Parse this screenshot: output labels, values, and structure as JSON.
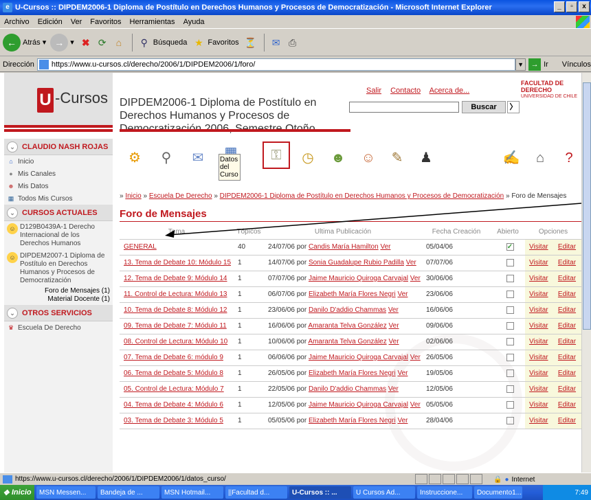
{
  "window": {
    "title": "U-Cursos :: DIPDEM2006-1 Diploma de Postítulo en Derechos Humanos y Procesos de Democratización - Microsoft Internet Explorer",
    "min": "_",
    "restore": "▫",
    "close": "x"
  },
  "menu": [
    "Archivo",
    "Edición",
    "Ver",
    "Favoritos",
    "Herramientas",
    "Ayuda"
  ],
  "toolbar": {
    "back": "Atrás",
    "search": "Búsqueda",
    "favorites": "Favoritos"
  },
  "address": {
    "label": "Dirección",
    "url": "https://www.u-cursos.cl/derecho/2006/1/DIPDEM2006/1/foro/",
    "go": "Ir",
    "links": "Vínculos"
  },
  "site": {
    "logo_letter": "U",
    "logo_text": "-Cursos",
    "course_title": "DIPDEM2006-1 Diploma de Postítulo en Derechos Humanos y Procesos de Democratización 2006, Semestre Otoño",
    "links": [
      "Salir",
      "Contacto",
      "Acerca de..."
    ],
    "search_button": "Buscar",
    "search_arrow": "〉",
    "faculty": "FACULTAD DE DERECHO",
    "faculty_sub": "UNIVERSIDAD DE CHILE"
  },
  "sidebar": {
    "user": "CLAUDIO NASH ROJAS",
    "user_items": [
      "Inicio",
      "Mis Canales",
      "Mis Datos",
      "Todos Mis Cursos"
    ],
    "current_courses_header": "CURSOS ACTUALES",
    "courses": [
      "D129B0439A-1 Derecho Internacional de los Derechos Humanos",
      "DIPDEM2007-1 Diploma de Postítulo en Derechos Humanos y Procesos de Democratización"
    ],
    "course_sub": [
      "Foro de Mensajes (1)",
      "Material Docente (1)"
    ],
    "other_header": "OTROS SERVICIOS",
    "other_items": [
      "Escuela De Derecho"
    ]
  },
  "iconbar": {
    "tooltip": "Datos del Curso"
  },
  "breadcrumb": {
    "prefix": "»",
    "items": [
      "Inicio",
      "Escuela De Derecho",
      "DIPDEM2006-1 Diploma de Postítulo en Derechos Humanos y Procesos de Democratización"
    ],
    "current": "Foro de Mensajes"
  },
  "forum": {
    "title": "Foro de Mensajes",
    "columns": [
      "Tema",
      "Tópicos",
      "Ultima Publicación",
      "Fecha Creación",
      "Abierto",
      "Opciones"
    ],
    "visit": "Visitar",
    "edit": "Editar",
    "rows": [
      {
        "tema": "GENERAL",
        "topicos": "40",
        "fecha": "24/07/06",
        "autor": "Candis María Hamilton",
        "creacion": "05/04/06",
        "abierto": true
      },
      {
        "tema": "13. Tema de Debate 10: Módulo 15",
        "topicos": "1",
        "fecha": "14/07/06",
        "autor": "Sonia Guadalupe Rubio Padilla",
        "creacion": "07/07/06",
        "abierto": false
      },
      {
        "tema": "12. Tema de Debate 9: Módulo 14",
        "topicos": "1",
        "fecha": "07/07/06",
        "autor": "Jaime Mauricio Quiroga Carvajal",
        "creacion": "30/06/06",
        "abierto": false
      },
      {
        "tema": "11. Control de Lectura: Módulo 13",
        "topicos": "1",
        "fecha": "06/07/06",
        "autor": "Elizabeth María Flores Negri",
        "creacion": "23/06/06",
        "abierto": false
      },
      {
        "tema": "10. Tema de Debate 8: Módulo 12",
        "topicos": "1",
        "fecha": "23/06/06",
        "autor": "Danilo D'addio Chammas",
        "creacion": "16/06/06",
        "abierto": false
      },
      {
        "tema": "09. Tema de Debate 7: Módulo 11",
        "topicos": "1",
        "fecha": "16/06/06",
        "autor": "Amaranta Telva González",
        "creacion": "09/06/06",
        "abierto": false
      },
      {
        "tema": "08. Control de Lectura: Módulo 10",
        "topicos": "1",
        "fecha": "10/06/06",
        "autor": "Amaranta Telva González",
        "creacion": "02/06/06",
        "abierto": false
      },
      {
        "tema": "07. Tema de Debate 6: módulo 9",
        "topicos": "1",
        "fecha": "06/06/06",
        "autor": "Jaime Mauricio Quiroga Carvajal",
        "creacion": "26/05/06",
        "abierto": false
      },
      {
        "tema": "06. Tema de Debate 5: Módulo 8",
        "topicos": "1",
        "fecha": "26/05/06",
        "autor": "Elizabeth María Flores Negri",
        "creacion": "19/05/06",
        "abierto": false
      },
      {
        "tema": "05. Control de Lectura: Módulo 7",
        "topicos": "1",
        "fecha": "22/05/06",
        "autor": "Danilo D'addio Chammas",
        "creacion": "12/05/06",
        "abierto": false
      },
      {
        "tema": "04. Tema de Debate 4: Módulo 6",
        "topicos": "1",
        "fecha": "12/05/06",
        "autor": "Jaime Mauricio Quiroga Carvajal",
        "creacion": "05/05/06",
        "abierto": false
      },
      {
        "tema": "03. Tema de Debate 3: Módulo 5",
        "topicos": "1",
        "fecha": "05/05/06",
        "autor": "Elizabeth María Flores Negri",
        "creacion": "28/04/06",
        "abierto": false
      }
    ],
    "por": "por",
    "ver": "Ver"
  },
  "status": {
    "url": "https://www.u-cursos.cl/derecho/2006/1/DIPDEM2006/1/datos_curso/",
    "zone": "Internet"
  },
  "taskbar": {
    "start": "Inicio",
    "tasks": [
      "MSN Messen...",
      "Bandeja de ...",
      "MSN Hotmail...",
      "||Facultad d...",
      "U-Cursos :: ...",
      "U Cursos Ad...",
      "Instruccione...",
      "Documento1..."
    ],
    "clock": "7:49"
  }
}
